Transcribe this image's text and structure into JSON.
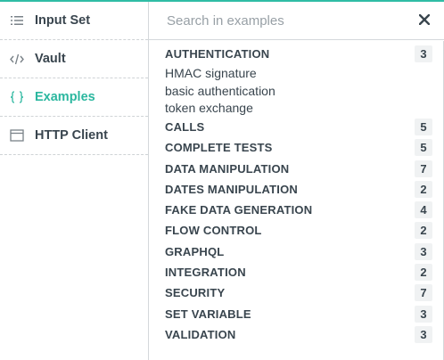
{
  "sidebar": {
    "items": [
      {
        "label": "Input Set",
        "icon": "list-icon",
        "active": false
      },
      {
        "label": "Vault",
        "icon": "code-icon",
        "active": false
      },
      {
        "label": "Examples",
        "icon": "braces-icon",
        "active": true
      },
      {
        "label": "HTTP Client",
        "icon": "browser-window-icon",
        "active": false
      }
    ]
  },
  "colors": {
    "accent": "#2bb79f",
    "text": "#39454e",
    "muted": "#98a0a6",
    "border": "#d4d8db"
  },
  "search": {
    "placeholder": "Search in examples",
    "value": ""
  },
  "examples": {
    "categories": [
      {
        "label": "AUTHENTICATION",
        "count": "3",
        "expanded": true,
        "children": [
          "HMAC signature",
          "basic authentication",
          "token exchange"
        ]
      },
      {
        "label": "CALLS",
        "count": "5"
      },
      {
        "label": "COMPLETE TESTS",
        "count": "5"
      },
      {
        "label": "DATA MANIPULATION",
        "count": "7"
      },
      {
        "label": "DATES MANIPULATION",
        "count": "2"
      },
      {
        "label": "FAKE DATA GENERATION",
        "count": "4"
      },
      {
        "label": "FLOW CONTROL",
        "count": "2"
      },
      {
        "label": "GRAPHQL",
        "count": "3"
      },
      {
        "label": "INTEGRATION",
        "count": "2"
      },
      {
        "label": "SECURITY",
        "count": "7"
      },
      {
        "label": "SET VARIABLE",
        "count": "3"
      },
      {
        "label": "VALIDATION",
        "count": "3"
      }
    ]
  }
}
